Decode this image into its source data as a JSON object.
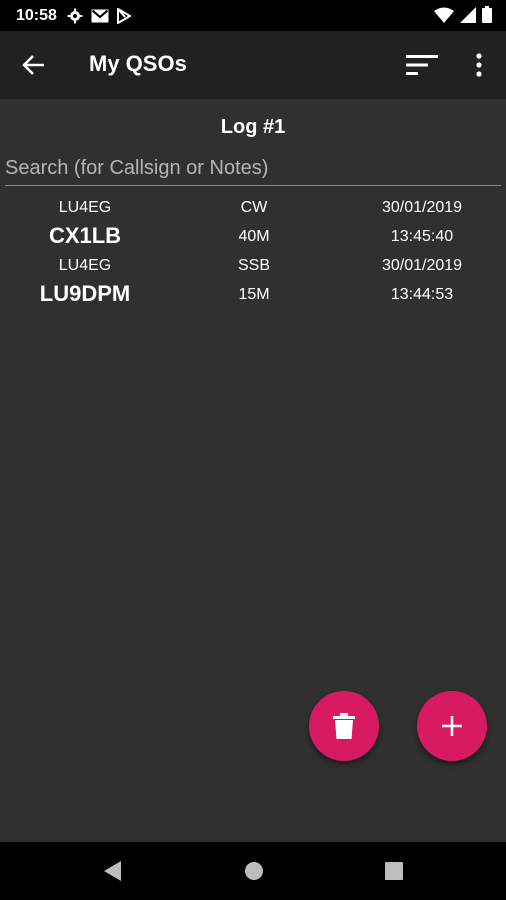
{
  "status_bar": {
    "time": "10:58",
    "left_icons": [
      "gear-icon",
      "gmail-icon",
      "play-store-icon"
    ],
    "right_icons": [
      "wifi-icon",
      "signal-icon",
      "battery-icon"
    ]
  },
  "app_bar": {
    "title": "My QSOs",
    "actions": [
      "sort-icon",
      "more-vert-icon"
    ]
  },
  "log": {
    "title": "Log #1"
  },
  "search": {
    "placeholder": "Search (for Callsign or Notes)",
    "value": ""
  },
  "qsos": [
    {
      "operator": "LU4EG",
      "callsign": "CX1LB",
      "mode": "CW",
      "band": "40M",
      "date": "30/01/2019",
      "time": "13:45:40"
    },
    {
      "operator": "LU4EG",
      "callsign": "LU9DPM",
      "mode": "SSB",
      "band": "15M",
      "date": "30/01/2019",
      "time": "13:44:53"
    }
  ],
  "fabs": {
    "delete_icon": "trash-icon",
    "add_icon": "plus-icon"
  },
  "colors": {
    "background": "#303030",
    "app_bar": "#212121",
    "accent": "#d81b60"
  }
}
